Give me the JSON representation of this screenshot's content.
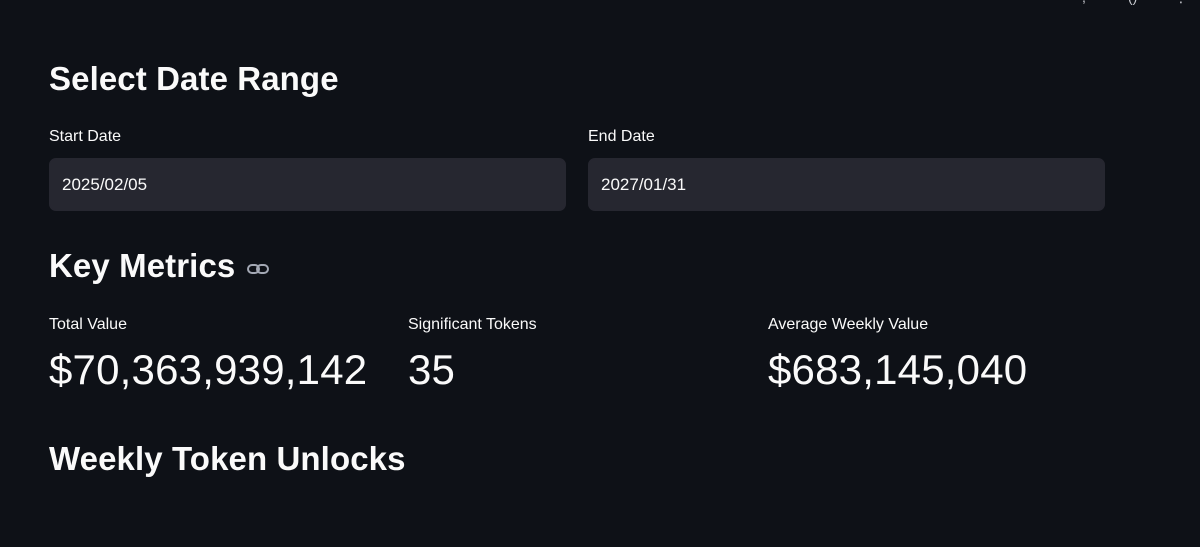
{
  "date_range": {
    "title": "Select Date Range",
    "start_label": "Start Date",
    "start_value": "2025/02/05",
    "end_label": "End Date",
    "end_value": "2027/01/31"
  },
  "key_metrics": {
    "title": "Key Metrics",
    "link_icon": "link-icon",
    "items": [
      {
        "label": "Total Value",
        "value": "$70,363,939,142"
      },
      {
        "label": "Significant Tokens",
        "value": "35"
      },
      {
        "label": "Average Weekly Value",
        "value": "$683,145,040"
      }
    ]
  },
  "weekly_unlocks": {
    "title": "Weekly Token Unlocks"
  },
  "colors": {
    "background": "#0e1117",
    "input_background": "#262730",
    "text": "#fafafa"
  }
}
